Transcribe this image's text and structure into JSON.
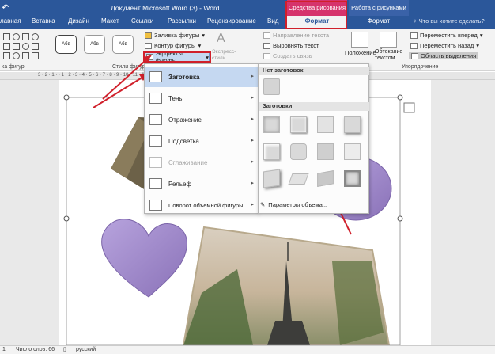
{
  "titlebar": {
    "qat_icon": "undo-icon",
    "doc_title": "Документ Microsoft Word (3)  -  Word",
    "ctx_drawing": "Средства рисования",
    "ctx_picture": "Работа с рисунками"
  },
  "tabs": [
    "лавная",
    "Вставка",
    "Дизайн",
    "Макет",
    "Ссылки",
    "Рассылки",
    "Рецензирование",
    "Вид"
  ],
  "tab_format_active": "Формат",
  "tab_format_picture": "Формат",
  "tellme": "Что вы хотите сделать?",
  "ribbon": {
    "style_samples": [
      "Абв",
      "Абв",
      "Абв"
    ],
    "fill": "Заливка фигуры",
    "outline": "Контур фигуры",
    "effects": "Эффекты фигуры",
    "express_styles": "Экспресс-стили",
    "text_direction": "Направление текста",
    "align_text": "Выровнять текст",
    "create_link": "Создать связь",
    "position": "Положение",
    "wrap": "Обтекание текстом",
    "bring_forward": "Переместить вперед",
    "send_backward": "Переместить назад",
    "selection_pane": "Область выделения",
    "grp_shapes": "ка фигур",
    "grp_styles": "Стили фигур",
    "grp_arrange": "Упорядочение",
    "accent_color": "#2b579a",
    "highlight_color": "#d0202b"
  },
  "ruler": "3 · 2 · 1 · · 1 · 2 · 3 · 4 · 5 · 6 · 7 · 8 · 9 · 10 · 11 · 12 · 13 · 14 · 15 · 16 · 17 ·",
  "menu": {
    "items": [
      {
        "label": "Заготовка",
        "icon": "preset-icon"
      },
      {
        "label": "Тень",
        "icon": "shadow-icon"
      },
      {
        "label": "Отражение",
        "icon": "reflection-icon"
      },
      {
        "label": "Подсветка",
        "icon": "glow-icon"
      },
      {
        "label": "Сглаживание",
        "icon": "soft-edges-icon"
      },
      {
        "label": "Рельеф",
        "icon": "bevel-icon"
      },
      {
        "label": "Поворот объемной фигуры",
        "icon": "3d-rotation-icon"
      }
    ]
  },
  "flyout": {
    "no_preset": "Нет заготовок",
    "presets_header": "Заготовки",
    "footer": "Параметры объема..."
  },
  "status": {
    "page": "1",
    "words": "Число слов: 66",
    "language": "русский"
  },
  "colors": {
    "heart": "#9b85c6",
    "menu_hover": "#c5d8f1"
  }
}
